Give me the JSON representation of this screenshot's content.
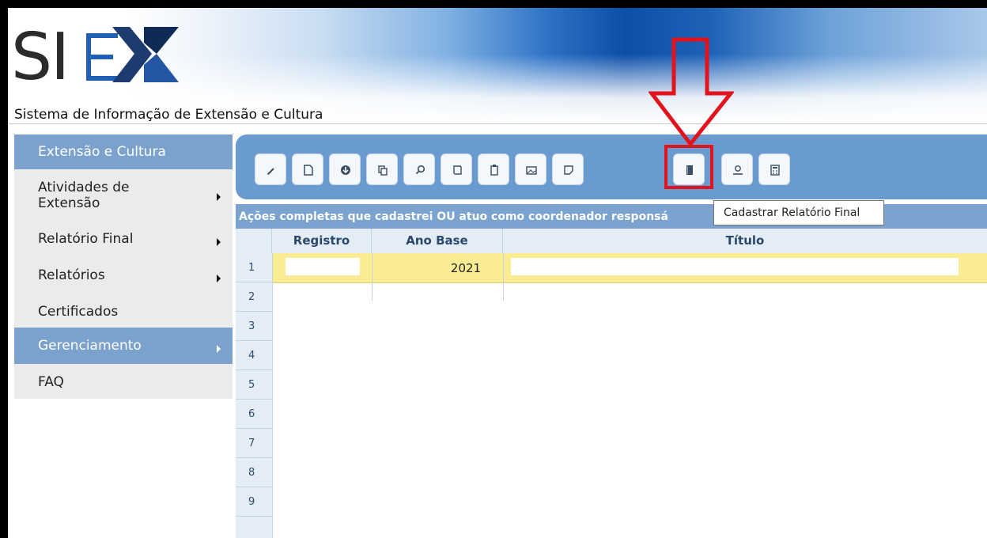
{
  "app": {
    "logo_text": "SIEX",
    "subtitle": "Sistema de Informação de Extensão e Cultura"
  },
  "sidebar": {
    "items": [
      {
        "label": "Extensão e Cultura",
        "active": true,
        "has_submenu": false
      },
      {
        "label": "Atividades de\nExtensão",
        "active": false,
        "has_submenu": true
      },
      {
        "label": "Relatório Final",
        "active": false,
        "has_submenu": true
      },
      {
        "label": "Relatórios",
        "active": false,
        "has_submenu": true
      },
      {
        "label": "Certificados",
        "active": false,
        "has_submenu": false
      },
      {
        "label": "Gerenciamento",
        "active": true,
        "has_submenu": true
      },
      {
        "label": "FAQ",
        "active": false,
        "has_submenu": false
      }
    ]
  },
  "toolbar": {
    "buttons": [
      {
        "icon": "pencil-icon"
      },
      {
        "icon": "new-document-icon"
      },
      {
        "icon": "download-icon"
      },
      {
        "icon": "copy-icon"
      },
      {
        "icon": "search-icon"
      },
      {
        "icon": "scroll-icon"
      },
      {
        "icon": "clipboard-icon"
      },
      {
        "icon": "image-icon"
      },
      {
        "icon": "note-icon"
      },
      {
        "icon": "report-book-icon",
        "highlighted": true
      },
      {
        "icon": "user-icon"
      },
      {
        "icon": "calculator-icon"
      }
    ],
    "tooltip": "Cadastrar Relatório Final"
  },
  "grid": {
    "caption": "Ações completas que cadastrei OU atuo como coordenador responsá",
    "columns": [
      "Registro",
      "Ano Base",
      "Título"
    ],
    "rows": [
      {
        "num": "1",
        "registro": "",
        "ano_base": "2021",
        "titulo": ""
      }
    ],
    "row_numbers": [
      "1",
      "2",
      "3",
      "4",
      "5",
      "6",
      "7",
      "8",
      "9"
    ]
  },
  "colors": {
    "accent": "#6a9bd0",
    "highlight_red": "#e1131d",
    "selected_row": "#f9ec92"
  }
}
